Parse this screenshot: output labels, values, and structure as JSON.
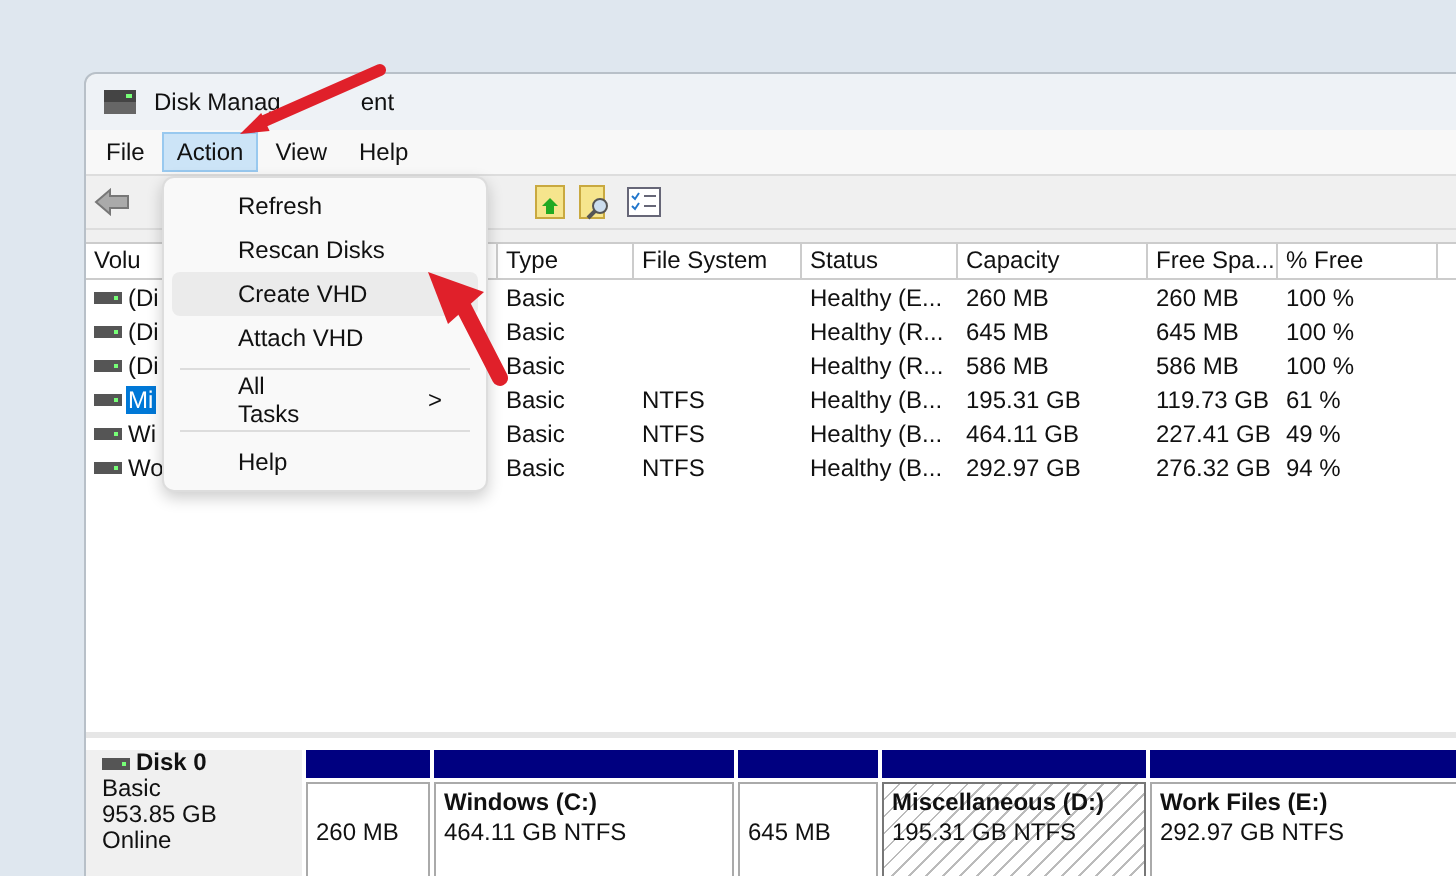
{
  "window": {
    "title_parts": [
      "Disk Manag",
      "ent"
    ]
  },
  "menu_bar": [
    {
      "label": "File",
      "selected": false
    },
    {
      "label": "Action",
      "selected": true
    },
    {
      "label": "View",
      "selected": false
    },
    {
      "label": "Help",
      "selected": false
    }
  ],
  "action_menu": {
    "items": [
      {
        "kind": "item",
        "label": "Refresh",
        "hovered": false
      },
      {
        "kind": "item",
        "label": "Rescan Disks",
        "hovered": false
      },
      {
        "kind": "item",
        "label": "Create VHD",
        "hovered": true
      },
      {
        "kind": "item",
        "label": "Attach VHD",
        "hovered": false
      },
      {
        "kind": "separator"
      },
      {
        "kind": "submenu",
        "label": "All Tasks",
        "arrow": ">",
        "hovered": false
      },
      {
        "kind": "separator"
      },
      {
        "kind": "item",
        "label": "Help",
        "hovered": false
      }
    ]
  },
  "volume_table": {
    "columns": [
      "Volu",
      "Type",
      "File System",
      "Status",
      "Capacity",
      "Free Spa...",
      "% Free"
    ],
    "rows": [
      {
        "cells": [
          "(Di",
          "Basic",
          "",
          "Healthy (E...",
          "260 MB",
          "260 MB",
          "100 %"
        ],
        "selected": false
      },
      {
        "cells": [
          "(Di",
          "Basic",
          "",
          "Healthy (R...",
          "645 MB",
          "645 MB",
          "100 %"
        ],
        "selected": false
      },
      {
        "cells": [
          "(Di",
          "Basic",
          "",
          "Healthy (R...",
          "586 MB",
          "586 MB",
          "100 %"
        ],
        "selected": false
      },
      {
        "cells": [
          "Mi",
          "Basic",
          "NTFS",
          "Healthy (B...",
          "195.31 GB",
          "119.73 GB",
          "61 %"
        ],
        "selected": true
      },
      {
        "cells": [
          "Wi",
          "Basic",
          "NTFS",
          "Healthy (B...",
          "464.11 GB",
          "227.41 GB",
          "49 %"
        ],
        "selected": false
      },
      {
        "cells": [
          "Wo",
          "Basic",
          "NTFS",
          "Healthy (B...",
          "292.97 GB",
          "276.32 GB",
          "94 %"
        ],
        "selected": false
      }
    ]
  },
  "disk": {
    "name": "Disk 0",
    "type": "Basic",
    "size": "953.85 GB",
    "status": "Online",
    "partitions": [
      {
        "size": "260 MB",
        "selected": false
      },
      {
        "name": "Windows  (C:)",
        "size": "464.11 GB NTFS",
        "selected": false
      },
      {
        "size": "645 MB",
        "selected": false
      },
      {
        "name": "Miscellaneous   (D:)",
        "size": "195.31 GB NTFS",
        "selected": true
      },
      {
        "name": "Work Files  (E:)",
        "size": "292.97 GB NTFS",
        "selected": false
      }
    ]
  }
}
